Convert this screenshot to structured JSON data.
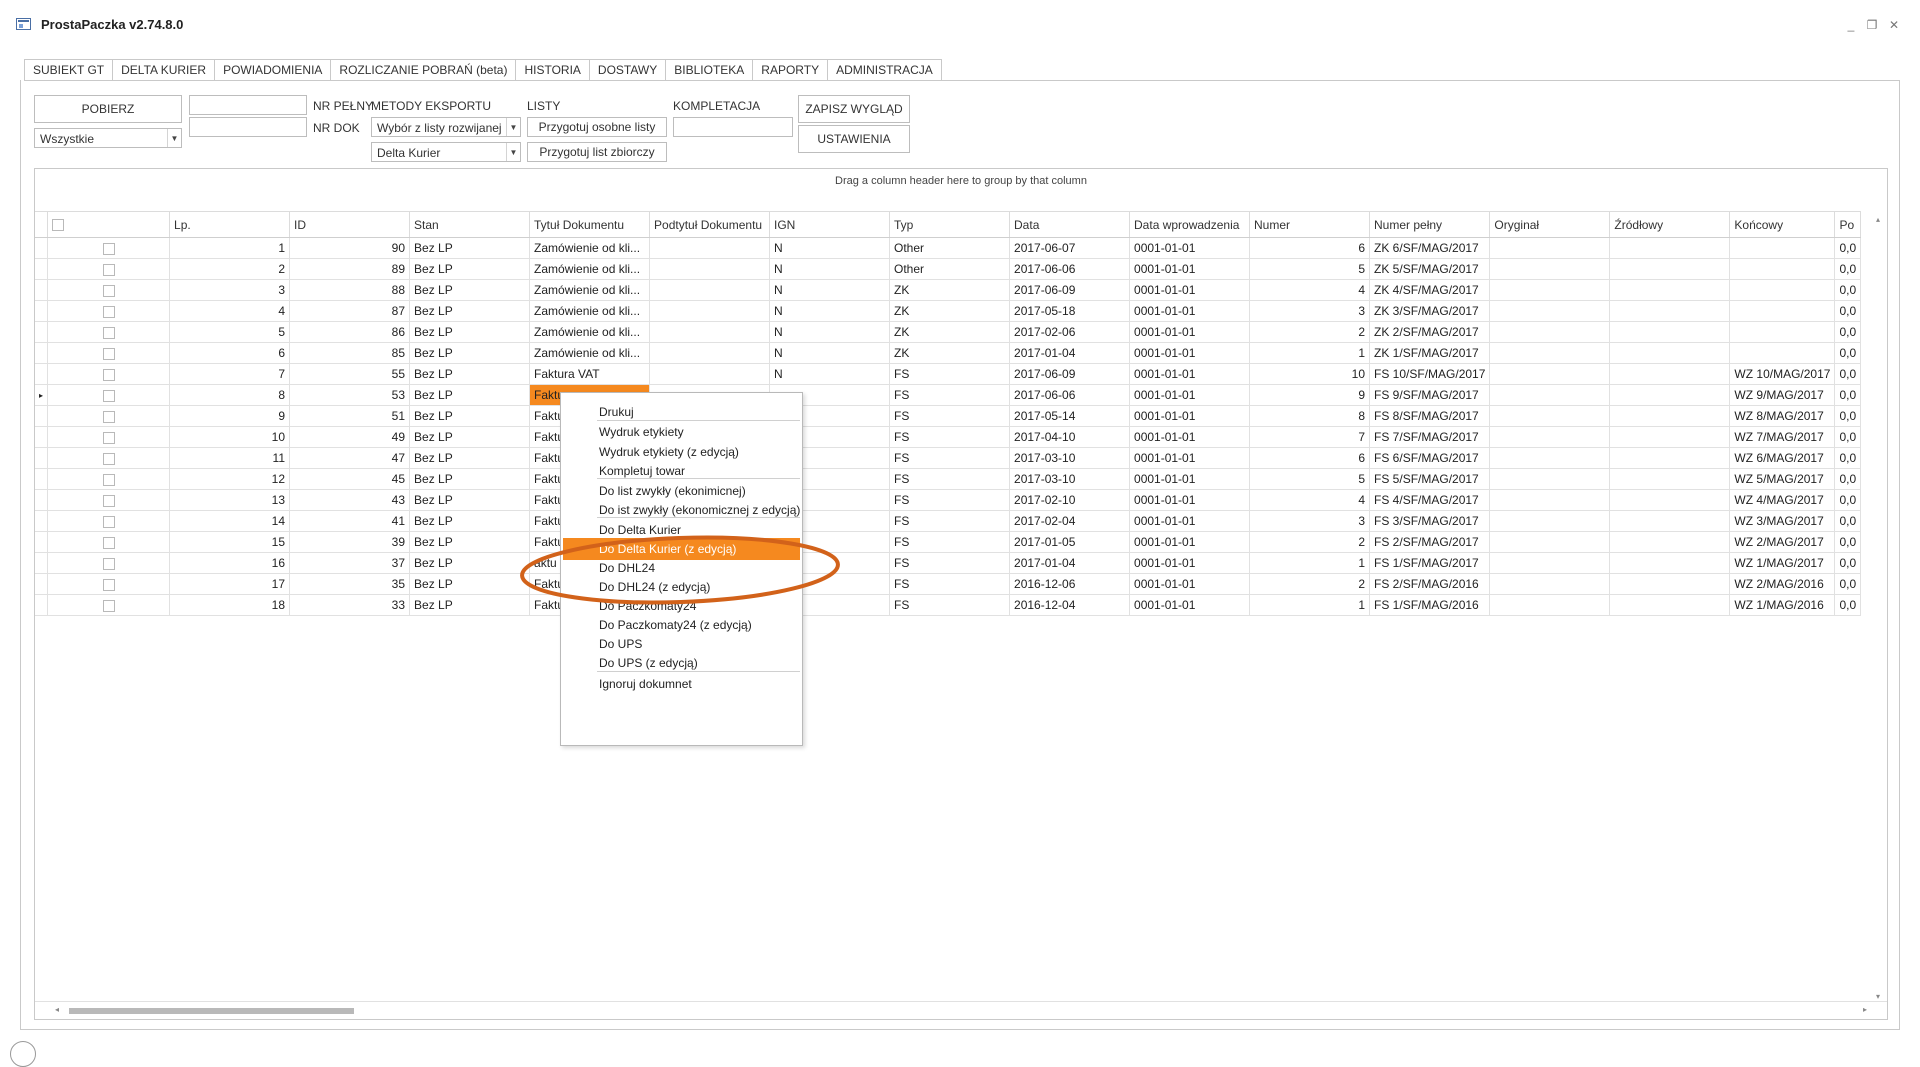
{
  "window": {
    "title": "ProstaPaczka v2.74.8.0",
    "minimize": "_",
    "restore": "❐",
    "close": "✕"
  },
  "tabs": [
    "SUBIEKT GT",
    "DELTA KURIER",
    "POWIADOMIENIA",
    "ROZLICZANIE POBRAŃ (beta)",
    "HISTORIA",
    "DOSTAWY",
    "BIBLIOTEKA",
    "RAPORTY",
    "ADMINISTRACJA"
  ],
  "active_tab": "SUBIEKT GT",
  "toolbar": {
    "pobierz_label": "POBIERZ",
    "filter_value": "Wszystkie",
    "nr_pelny_label": "NR PEŁNY",
    "nr_dok_label": "NR DOK",
    "metody_label": "METODY EKSPORTU",
    "metoda_select_value": "Wybór z listy rozwijanej",
    "kurier_select_value": "Delta Kurier",
    "listy_label": "LISTY",
    "osobne_listy_label": "Przygotuj osobne listy",
    "list_zbiorczy_label": "Przygotuj list zbiorczy",
    "kompletacja_label": "KOMPLETACJA",
    "zapisz_label": "ZAPISZ WYGLĄD",
    "ustawienia_label": "USTAWIENIA"
  },
  "grid": {
    "group_hint": "Drag a column header here to group by that column",
    "columns": [
      "Lp.",
      "ID",
      "Stan",
      "Tytuł Dokumentu",
      "Podtytuł Dokumentu",
      "IGN",
      "Typ",
      "Data",
      "Data wprowadzenia",
      "Numer",
      "Numer pełny",
      "Oryginał",
      "Źródłowy",
      "Końcowy",
      "Po"
    ],
    "rows": [
      {
        "lp": "1",
        "id": "90",
        "stan": "Bez LP",
        "tytul": "Zamówienie od kli...",
        "podtytul": "",
        "ign": "N",
        "typ": "Other",
        "data": "2017-06-07",
        "data_wpr": "0001-01-01",
        "numer": "6",
        "numer_pelny": "ZK 6/SF/MAG/2017",
        "oryginal": "",
        "zrodlowy": "",
        "koncowy": "",
        "po": "0,0"
      },
      {
        "lp": "2",
        "id": "89",
        "stan": "Bez LP",
        "tytul": "Zamówienie od kli...",
        "podtytul": "",
        "ign": "N",
        "typ": "Other",
        "data": "2017-06-06",
        "data_wpr": "0001-01-01",
        "numer": "5",
        "numer_pelny": "ZK 5/SF/MAG/2017",
        "oryginal": "",
        "zrodlowy": "",
        "koncowy": "",
        "po": "0,0"
      },
      {
        "lp": "3",
        "id": "88",
        "stan": "Bez LP",
        "tytul": "Zamówienie od kli...",
        "podtytul": "",
        "ign": "N",
        "typ": "ZK",
        "data": "2017-06-09",
        "data_wpr": "0001-01-01",
        "numer": "4",
        "numer_pelny": "ZK 4/SF/MAG/2017",
        "oryginal": "",
        "zrodlowy": "",
        "koncowy": "",
        "po": "0,0"
      },
      {
        "lp": "4",
        "id": "87",
        "stan": "Bez LP",
        "tytul": "Zamówienie od kli...",
        "podtytul": "",
        "ign": "N",
        "typ": "ZK",
        "data": "2017-05-18",
        "data_wpr": "0001-01-01",
        "numer": "3",
        "numer_pelny": "ZK 3/SF/MAG/2017",
        "oryginal": "",
        "zrodlowy": "",
        "koncowy": "",
        "po": "0,0"
      },
      {
        "lp": "5",
        "id": "86",
        "stan": "Bez LP",
        "tytul": "Zamówienie od kli...",
        "podtytul": "",
        "ign": "N",
        "typ": "ZK",
        "data": "2017-02-06",
        "data_wpr": "0001-01-01",
        "numer": "2",
        "numer_pelny": "ZK 2/SF/MAG/2017",
        "oryginal": "",
        "zrodlowy": "",
        "koncowy": "",
        "po": "0,0"
      },
      {
        "lp": "6",
        "id": "85",
        "stan": "Bez LP",
        "tytul": "Zamówienie od kli...",
        "podtytul": "",
        "ign": "N",
        "typ": "ZK",
        "data": "2017-01-04",
        "data_wpr": "0001-01-01",
        "numer": "1",
        "numer_pelny": "ZK 1/SF/MAG/2017",
        "oryginal": "",
        "zrodlowy": "",
        "koncowy": "",
        "po": "0,0"
      },
      {
        "lp": "7",
        "id": "55",
        "stan": "Bez LP",
        "tytul": "Faktura VAT",
        "podtytul": "",
        "ign": "N",
        "typ": "FS",
        "data": "2017-06-09",
        "data_wpr": "0001-01-01",
        "numer": "10",
        "numer_pelny": "FS 10/SF/MAG/2017",
        "oryginal": "",
        "zrodlowy": "",
        "koncowy": "WZ 10/MAG/2017",
        "po": "0,0"
      },
      {
        "lp": "8",
        "id": "53",
        "stan": "Bez LP",
        "tytul": "Faktu",
        "podtytul": "",
        "ign": "",
        "typ": "FS",
        "data": "2017-06-06",
        "data_wpr": "0001-01-01",
        "numer": "9",
        "numer_pelny": "FS 9/SF/MAG/2017",
        "oryginal": "",
        "zrodlowy": "",
        "koncowy": "WZ 9/MAG/2017",
        "po": "0,0"
      },
      {
        "lp": "9",
        "id": "51",
        "stan": "Bez LP",
        "tytul": "Faktu",
        "podtytul": "",
        "ign": "",
        "typ": "FS",
        "data": "2017-05-14",
        "data_wpr": "0001-01-01",
        "numer": "8",
        "numer_pelny": "FS 8/SF/MAG/2017",
        "oryginal": "",
        "zrodlowy": "",
        "koncowy": "WZ 8/MAG/2017",
        "po": "0,0"
      },
      {
        "lp": "10",
        "id": "49",
        "stan": "Bez LP",
        "tytul": "Faktu",
        "podtytul": "",
        "ign": "",
        "typ": "FS",
        "data": "2017-04-10",
        "data_wpr": "0001-01-01",
        "numer": "7",
        "numer_pelny": "FS 7/SF/MAG/2017",
        "oryginal": "",
        "zrodlowy": "",
        "koncowy": "WZ 7/MAG/2017",
        "po": "0,0"
      },
      {
        "lp": "11",
        "id": "47",
        "stan": "Bez LP",
        "tytul": "Faktu",
        "podtytul": "",
        "ign": "",
        "typ": "FS",
        "data": "2017-03-10",
        "data_wpr": "0001-01-01",
        "numer": "6",
        "numer_pelny": "FS 6/SF/MAG/2017",
        "oryginal": "",
        "zrodlowy": "",
        "koncowy": "WZ 6/MAG/2017",
        "po": "0,0"
      },
      {
        "lp": "12",
        "id": "45",
        "stan": "Bez LP",
        "tytul": "Faktu",
        "podtytul": "",
        "ign": "",
        "typ": "FS",
        "data": "2017-03-10",
        "data_wpr": "0001-01-01",
        "numer": "5",
        "numer_pelny": "FS 5/SF/MAG/2017",
        "oryginal": "",
        "zrodlowy": "",
        "koncowy": "WZ 5/MAG/2017",
        "po": "0,0"
      },
      {
        "lp": "13",
        "id": "43",
        "stan": "Bez LP",
        "tytul": "Faktu",
        "podtytul": "",
        "ign": "",
        "typ": "FS",
        "data": "2017-02-10",
        "data_wpr": "0001-01-01",
        "numer": "4",
        "numer_pelny": "FS 4/SF/MAG/2017",
        "oryginal": "",
        "zrodlowy": "",
        "koncowy": "WZ 4/MAG/2017",
        "po": "0,0"
      },
      {
        "lp": "14",
        "id": "41",
        "stan": "Bez LP",
        "tytul": "Faktu",
        "podtytul": "",
        "ign": "",
        "typ": "FS",
        "data": "2017-02-04",
        "data_wpr": "0001-01-01",
        "numer": "3",
        "numer_pelny": "FS 3/SF/MAG/2017",
        "oryginal": "",
        "zrodlowy": "",
        "koncowy": "WZ 3/MAG/2017",
        "po": "0,0"
      },
      {
        "lp": "15",
        "id": "39",
        "stan": "Bez LP",
        "tytul": "Faktu",
        "podtytul": "",
        "ign": "",
        "typ": "FS",
        "data": "2017-01-05",
        "data_wpr": "0001-01-01",
        "numer": "2",
        "numer_pelny": "FS 2/SF/MAG/2017",
        "oryginal": "",
        "zrodlowy": "",
        "koncowy": "WZ 2/MAG/2017",
        "po": "0,0"
      },
      {
        "lp": "16",
        "id": "37",
        "stan": "Bez LP",
        "tytul": "aktu",
        "podtytul": "",
        "ign": "",
        "typ": "FS",
        "data": "2017-01-04",
        "data_wpr": "0001-01-01",
        "numer": "1",
        "numer_pelny": "FS 1/SF/MAG/2017",
        "oryginal": "",
        "zrodlowy": "",
        "koncowy": "WZ 1/MAG/2017",
        "po": "0,0"
      },
      {
        "lp": "17",
        "id": "35",
        "stan": "Bez LP",
        "tytul": "Faktu",
        "podtytul": "",
        "ign": "",
        "typ": "FS",
        "data": "2016-12-06",
        "data_wpr": "0001-01-01",
        "numer": "2",
        "numer_pelny": "FS 2/SF/MAG/2016",
        "oryginal": "",
        "zrodlowy": "",
        "koncowy": "WZ 2/MAG/2016",
        "po": "0,0"
      },
      {
        "lp": "18",
        "id": "33",
        "stan": "Bez LP",
        "tytul": "Faktu",
        "podtytul": "",
        "ign": "",
        "typ": "FS",
        "data": "2016-12-04",
        "data_wpr": "0001-01-01",
        "numer": "1",
        "numer_pelny": "FS 1/SF/MAG/2016",
        "oryginal": "",
        "zrodlowy": "",
        "koncowy": "WZ 1/MAG/2016",
        "po": "0,0"
      }
    ],
    "selected_row": "8",
    "current_row_marker": "▸"
  },
  "context_menu": {
    "items": [
      "Drukuj",
      "Wydruk etykiety",
      "Wydruk etykiety (z edycją)",
      "Kompletuj towar",
      "Do list zwykły (ekonimicnej)",
      "Do ist zwykły (ekonomicznej z edycją)",
      "Do Delta Kurier",
      "Do Delta Kurier (z edycją)",
      "Do DHL24",
      "Do DHL24 (z edycją)",
      "Do Paczkomaty24",
      "Do Paczkomaty24 (z edycją)",
      "Do UPS",
      "Do UPS (z edycją)",
      "Ignoruj dokumnet"
    ],
    "highlighted": "Do Delta Kurier (z edycją)"
  },
  "colors": {
    "accent": "#f5891f",
    "annotation_ellipse": "#d2621a"
  },
  "icons": {
    "app": "app-window-icon",
    "combo": "chevron-down-icon",
    "scroll_left": "◂",
    "scroll_right": "▸",
    "scroll_up": "▴",
    "scroll_down": "▾"
  }
}
